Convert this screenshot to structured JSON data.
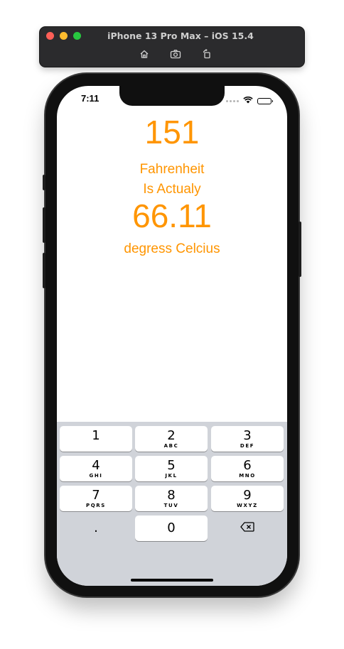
{
  "simulator": {
    "title": "iPhone 13 Pro Max – iOS 15.4",
    "tools": [
      "home-icon",
      "screenshot-icon",
      "rotate-icon"
    ]
  },
  "status_bar": {
    "time": "7:11"
  },
  "app": {
    "fahrenheit_value": "151",
    "fahrenheit_label": "Fahrenheit",
    "is_label": "Is Actualy",
    "celsius_value": "66.11",
    "celsius_label": "degress Celcius",
    "accent_color": "#ff9500"
  },
  "keyboard": {
    "keys": [
      {
        "digit": "1",
        "letters": ""
      },
      {
        "digit": "2",
        "letters": "ABC"
      },
      {
        "digit": "3",
        "letters": "DEF"
      },
      {
        "digit": "4",
        "letters": "GHI"
      },
      {
        "digit": "5",
        "letters": "JKL"
      },
      {
        "digit": "6",
        "letters": "MNO"
      },
      {
        "digit": "7",
        "letters": "PQRS"
      },
      {
        "digit": "8",
        "letters": "TUV"
      },
      {
        "digit": "9",
        "letters": "WXYZ"
      },
      {
        "digit": ".",
        "letters": ""
      },
      {
        "digit": "0",
        "letters": ""
      }
    ],
    "delete_icon": "backspace-icon"
  }
}
